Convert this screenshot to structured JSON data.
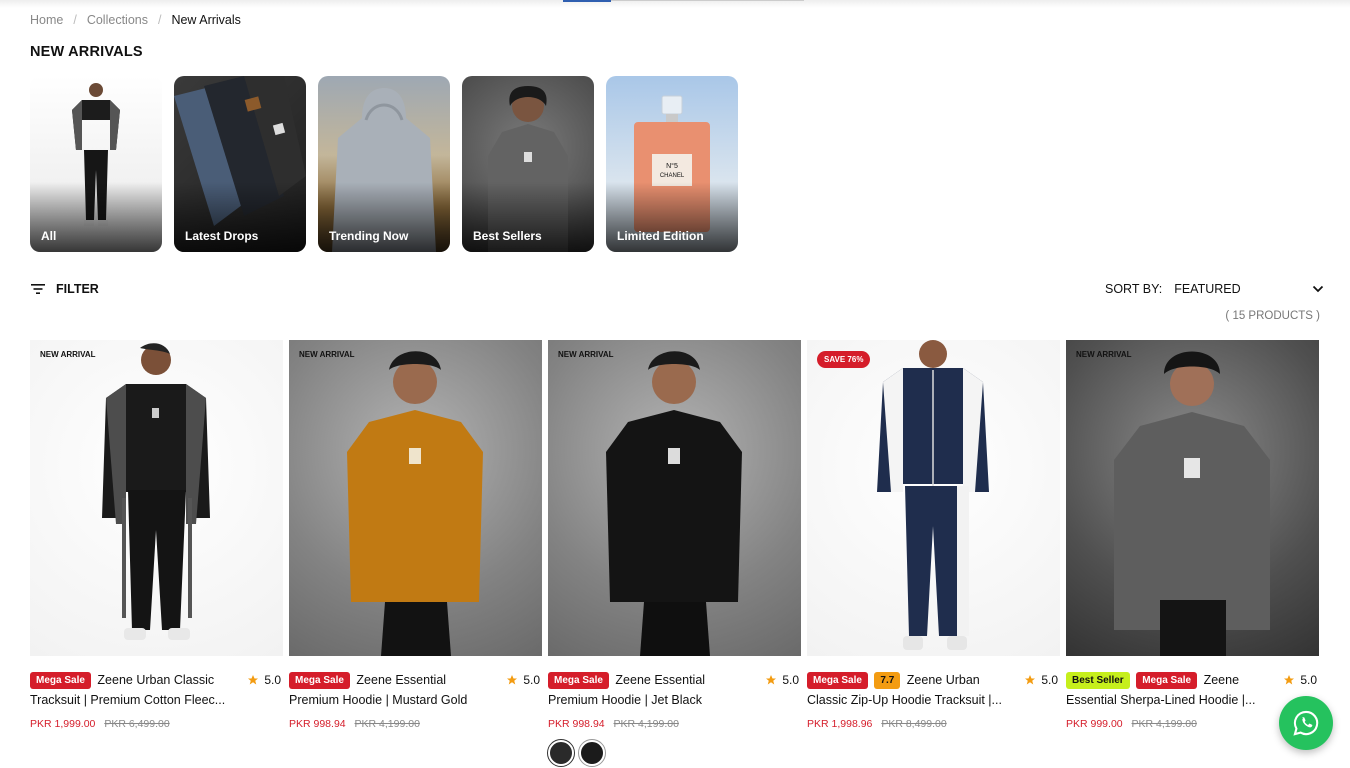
{
  "breadcrumb": {
    "home": "Home",
    "collections": "Collections",
    "current": "New Arrivals"
  },
  "page_title": "NEW ARRIVALS",
  "collections": [
    {
      "label": "All"
    },
    {
      "label": "Latest Drops"
    },
    {
      "label": "Trending Now"
    },
    {
      "label": "Best Sellers"
    },
    {
      "label": "Limited Edition"
    }
  ],
  "toolbar": {
    "filter_label": "FILTER",
    "sort_label": "SORT BY:",
    "sort_value": "FEATURED",
    "product_count": "( 15 PRODUCTS )"
  },
  "products": [
    {
      "tag": "NEW ARRIVAL",
      "badges": [
        "Mega Sale"
      ],
      "title": "Zeene Urban Classic Tracksuit | Premium Cotton Fleec...",
      "rating": "5.0",
      "price": "PKR 1,999.00",
      "compare_price": "PKR 6,499.00"
    },
    {
      "tag": "NEW ARRIVAL",
      "badges": [
        "Mega Sale"
      ],
      "title": "Zeene Essential Premium Hoodie | Mustard Gold",
      "rating": "5.0",
      "price": "PKR 998.94",
      "compare_price": "PKR 4,199.00"
    },
    {
      "tag": "NEW ARRIVAL",
      "badges": [
        "Mega Sale"
      ],
      "title": "Zeene Essential Premium Hoodie | Jet Black",
      "rating": "5.0",
      "price": "PKR 998.94",
      "compare_price": "PKR 4,199.00"
    },
    {
      "tag": "SAVE 76%",
      "badges": [
        "Mega Sale",
        "7.7"
      ],
      "title": "Zeene Urban Classic Zip-Up Hoodie Tracksuit |...",
      "rating": "5.0",
      "price": "PKR 1,998.96",
      "compare_price": "PKR 8,499.00"
    },
    {
      "tag": "NEW ARRIVAL",
      "badges": [
        "Best Seller",
        "Mega Sale"
      ],
      "title": "Zeene Essential Sherpa-Lined Hoodie |...",
      "rating": "5.0",
      "price": "PKR 999.00",
      "compare_price": "PKR 4,199.00"
    }
  ],
  "colors": {
    "sale_red": "#d51d2a",
    "rating_star": "#f39c12",
    "whatsapp": "#25c25e",
    "best_seller": "#c6ef1c"
  },
  "icons": [
    "filter-icon",
    "chevron-down-icon",
    "star-icon",
    "whatsapp-icon"
  ]
}
